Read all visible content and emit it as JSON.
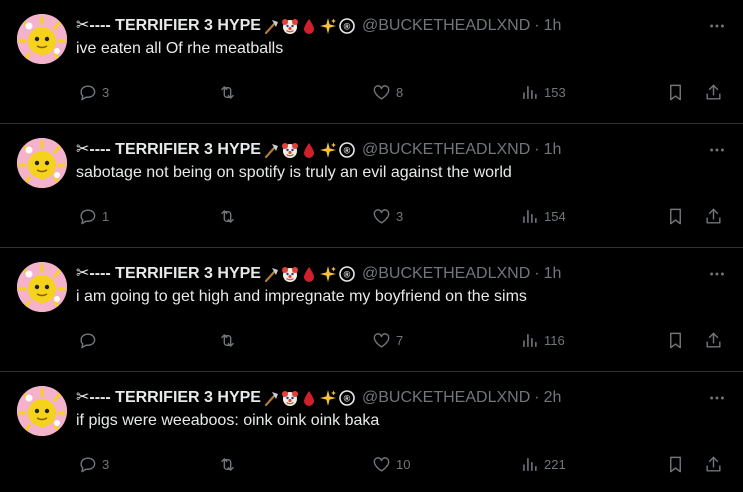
{
  "colors": {
    "background": "#000000",
    "text": "#e7e9ea",
    "muted": "#71767b",
    "divider": "#2f3336"
  },
  "icons": {
    "reply": "reply-icon",
    "retweet": "retweet-icon",
    "like": "heart-icon",
    "views": "views-icon",
    "bookmark": "bookmark-icon",
    "share": "share-icon",
    "more": "more-icon",
    "name_emojis": [
      "axe-icon",
      "clown-icon",
      "blood-drop-icon",
      "sparkles-icon",
      "registered-icon"
    ]
  },
  "more_label": "···",
  "tweets": [
    {
      "display_name": "✂---- TERRIFIER 3 HYPE",
      "handle": "@BUCKETHEADLXND",
      "separator": "·",
      "time": "1h",
      "text": "ive eaten all Of rhe meatballs",
      "replies": "3",
      "retweets": "",
      "likes": "8",
      "views": "153"
    },
    {
      "display_name": "✂---- TERRIFIER 3 HYPE",
      "handle": "@BUCKETHEADLXND",
      "separator": "·",
      "time": "1h",
      "text": "sabotage not being on spotify is truly an evil against the world",
      "replies": "1",
      "retweets": "",
      "likes": "3",
      "views": "154"
    },
    {
      "display_name": "✂---- TERRIFIER 3 HYPE",
      "handle": "@BUCKETHEADLXND",
      "separator": "·",
      "time": "1h",
      "text": "i am going to get high and impregnate my boyfriend on the sims",
      "replies": "",
      "retweets": "",
      "likes": "7",
      "views": "116"
    },
    {
      "display_name": "✂---- TERRIFIER 3 HYPE",
      "handle": "@BUCKETHEADLXND",
      "separator": "·",
      "time": "2h",
      "text": "if pigs were weeaboos: oink oink oink baka",
      "replies": "3",
      "retweets": "",
      "likes": "10",
      "views": "221"
    }
  ]
}
